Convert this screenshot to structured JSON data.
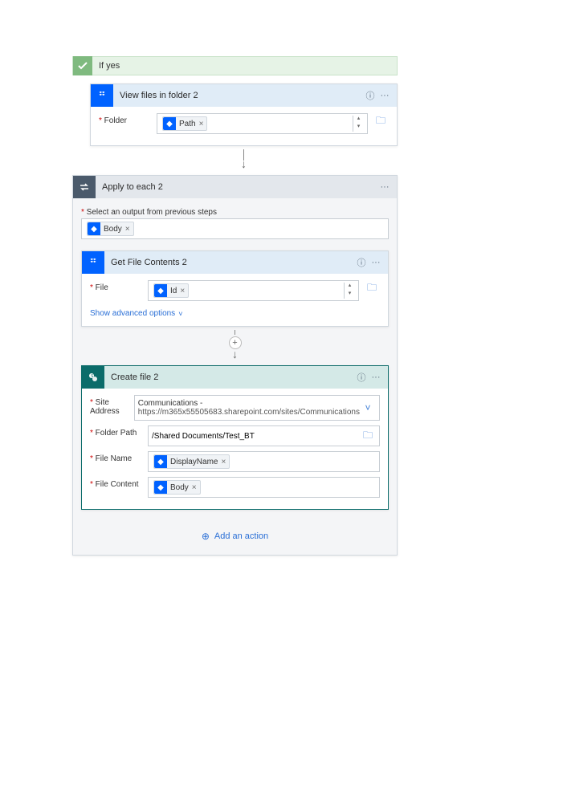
{
  "condition": {
    "title": "If yes"
  },
  "card1": {
    "title": "View files in folder 2",
    "folder_label": "Folder",
    "folder_token": "Path"
  },
  "loop": {
    "title": "Apply to each 2",
    "select_label": "Select an output from previous steps",
    "body_token": "Body"
  },
  "card2": {
    "title": "Get File Contents 2",
    "file_label": "File",
    "file_token": "Id",
    "advanced": "Show advanced options"
  },
  "card3": {
    "title": "Create file 2",
    "site_label": "Site Address",
    "site_value_name": "Communications -",
    "site_value_url": "https://m365x55505683.sharepoint.com/sites/Communications",
    "folder_label": "Folder Path",
    "folder_value": "/Shared Documents/Test_BT",
    "filename_label": "File Name",
    "filename_token": "DisplayName",
    "content_label": "File Content",
    "content_token": "Body"
  },
  "add_action": "Add an action"
}
